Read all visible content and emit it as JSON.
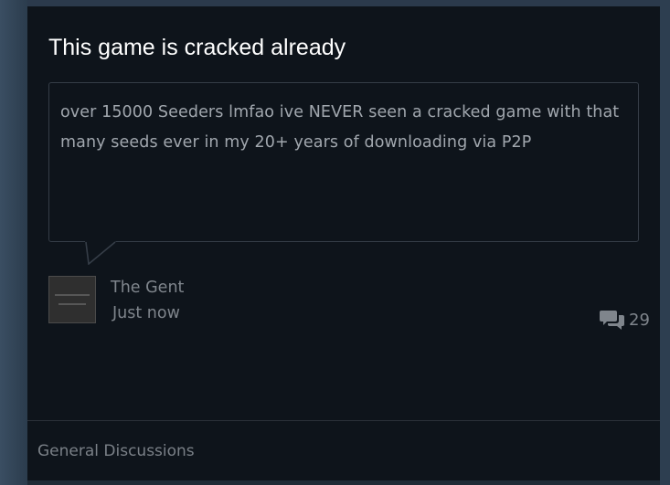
{
  "topic": {
    "title": "This game is cracked already",
    "body": "over 15000 Seeders lmfao ive NEVER seen a cracked game with that many seeds ever in my 20+ years of downloading via P2P",
    "author": "The Gent",
    "timestamp": "Just now",
    "reply_count": "29",
    "category": "General Discussions"
  },
  "icons": {
    "comments": "comments-icon",
    "avatar": "user-avatar"
  },
  "colors": {
    "card_background": "#0e141b",
    "title_text": "#ffffff",
    "body_text": "#a1a7ae",
    "meta_text": "#7f858c",
    "bubble_border": "#353d47"
  }
}
